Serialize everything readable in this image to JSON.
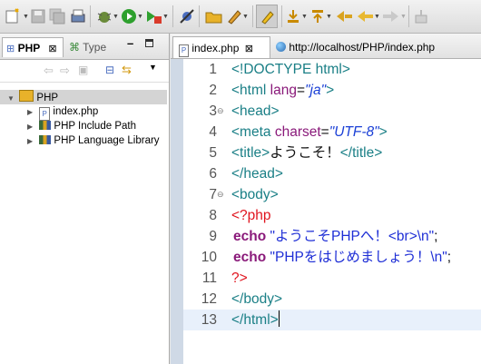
{
  "left_panel": {
    "tabs": [
      {
        "label": "PHP"
      },
      {
        "label": "Type"
      }
    ],
    "tree": {
      "root": "PHP",
      "children": [
        "index.php",
        "PHP Include Path",
        "PHP Language Library"
      ]
    }
  },
  "editor": {
    "tabs": [
      {
        "label": "index.php"
      },
      {
        "label": "http://localhost/PHP/index.php"
      }
    ],
    "line_numbers": [
      "1",
      "2",
      "3",
      "4",
      "5",
      "6",
      "7",
      "8",
      "9",
      "10",
      "11",
      "12",
      "13"
    ],
    "lines": [
      {
        "t1": "<!DOCTYPE html>"
      },
      {
        "t1": "<html ",
        "t2": "lang",
        "t3": "=",
        "t4": "\"ja\"",
        "t5": ">"
      },
      {
        "t1": "<head>"
      },
      {
        "t1": "<meta ",
        "t2": "charset",
        "t3": "=",
        "t4": "\"UTF-8\"",
        "t5": ">"
      },
      {
        "t1": "<title>",
        "t2": "ようこそ！",
        "t3": "</title>"
      },
      {
        "t1": "</head>"
      },
      {
        "t1": "<body>"
      },
      {
        "t1": "<?php"
      },
      {
        "t1": "echo ",
        "t2": "\"ようこそPHPへ！<br>\\n\"",
        "t3": ";"
      },
      {
        "t1": "echo ",
        "t2": "\"PHPをはじめましょう！\\n\"",
        "t3": ";"
      },
      {
        "t1": "?>"
      },
      {
        "t1": "</body>"
      },
      {
        "t1": "</html>"
      }
    ]
  },
  "colors": {
    "tag": "#1a7f86",
    "attr": "#8a1a7a",
    "string": "#1a3fd6",
    "php": "#e0141e",
    "gutter": "#cfd9e6"
  }
}
